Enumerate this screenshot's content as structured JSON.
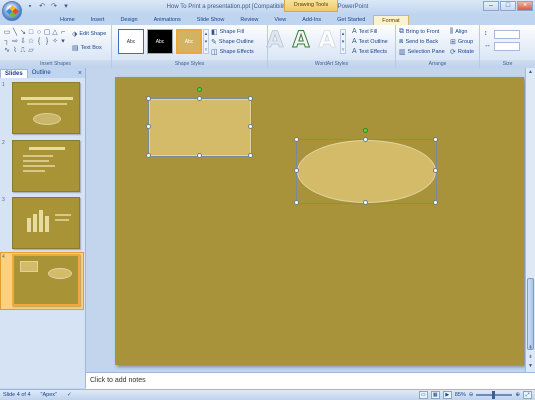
{
  "window": {
    "title": "How To Print a presentation.ppt [Compatibility Mode] - Microsoft PowerPoint",
    "contextual_tab_group": "Drawing Tools"
  },
  "quick_access": [
    "save-icon",
    "undo-icon",
    "redo-icon",
    "customize-icon"
  ],
  "tabs": [
    {
      "label": "Home"
    },
    {
      "label": "Insert"
    },
    {
      "label": "Design"
    },
    {
      "label": "Animations"
    },
    {
      "label": "Slide Show"
    },
    {
      "label": "Review"
    },
    {
      "label": "View"
    },
    {
      "label": "Add-Ins"
    },
    {
      "label": "Get Started"
    },
    {
      "label": "Format"
    }
  ],
  "active_tab": "Format",
  "ribbon": {
    "insert_shapes": {
      "label": "Insert Shapes",
      "edit_shape": "Edit Shape",
      "text_box": "Text Box"
    },
    "shape_styles": {
      "label": "Shape Styles",
      "thumb_text": "Abc",
      "shape_fill": "Shape Fill",
      "shape_outline": "Shape Outline",
      "shape_effects": "Shape Effects"
    },
    "wordart_styles": {
      "label": "WordArt Styles",
      "letter": "A",
      "text_fill": "Text Fill",
      "text_outline": "Text Outline",
      "text_effects": "Text Effects"
    },
    "arrange": {
      "label": "Arrange",
      "bring_to_front": "Bring to Front",
      "send_to_back": "Send to Back",
      "selection_pane": "Selection Pane",
      "align": "Align",
      "group": "Group",
      "rotate": "Rotate"
    },
    "size": {
      "label": "Size"
    }
  },
  "left_pane": {
    "tabs": [
      "Slides",
      "Outline"
    ],
    "active_tab": "Slides",
    "close_glyph": "×",
    "slides": [
      {
        "number": "1"
      },
      {
        "number": "2"
      },
      {
        "number": "3"
      },
      {
        "number": "4"
      }
    ],
    "selected_slide": "4"
  },
  "notes": {
    "placeholder": "Click to add notes"
  },
  "status_bar": {
    "slide_info": "Slide 4 of 4",
    "theme": "\"Apex\"",
    "zoom": "85%"
  },
  "colors": {
    "slide_background": "#a8933a",
    "shape_fill": "#d3bb6a",
    "ribbon_blue": "#15428b",
    "contextual_tab": "#f0c96b"
  }
}
